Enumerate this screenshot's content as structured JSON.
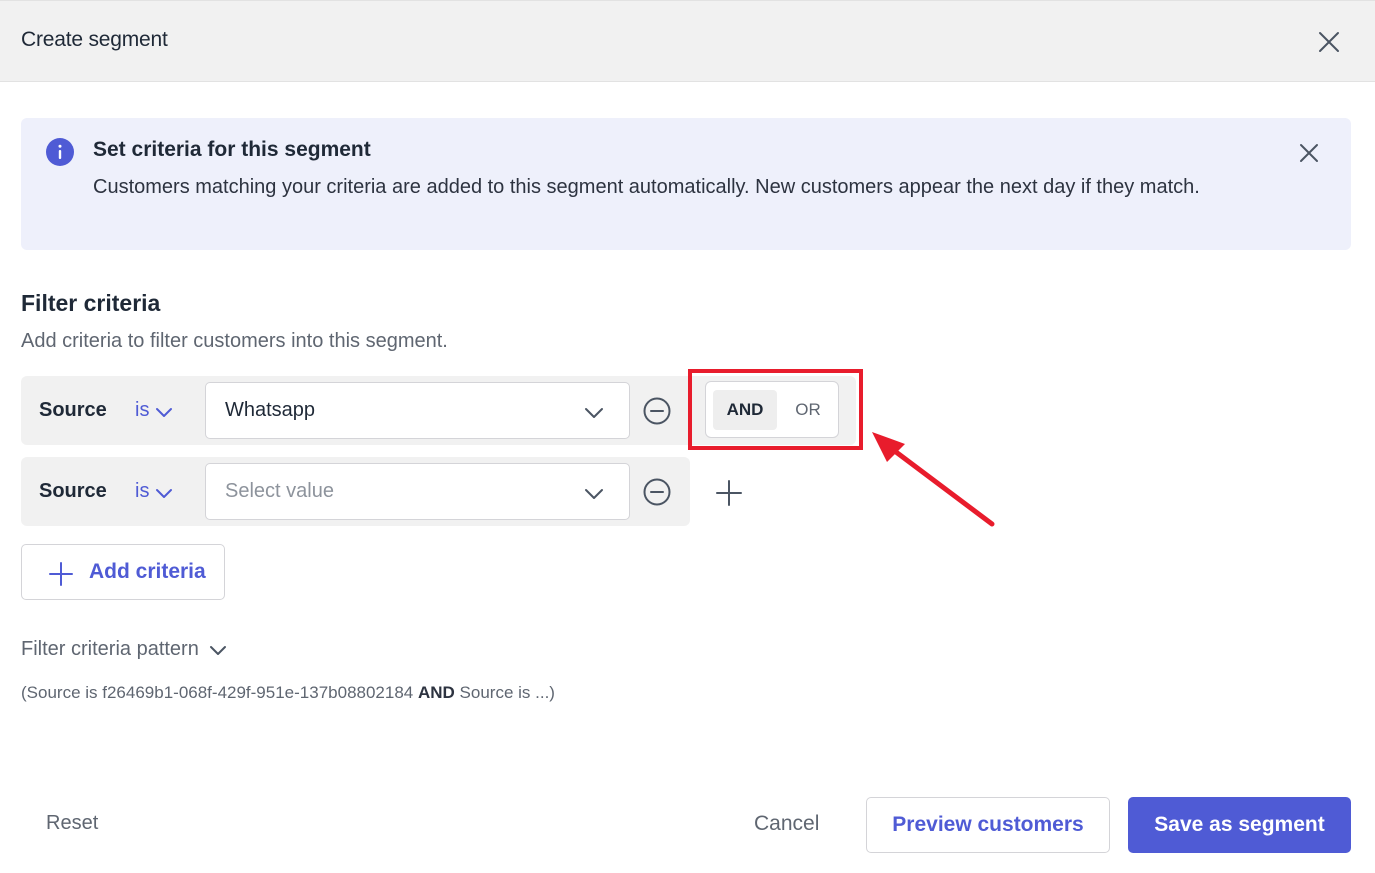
{
  "header": {
    "title": "Create segment",
    "close_icon": "close-icon"
  },
  "banner": {
    "icon": "info-icon",
    "title": "Set criteria for this segment",
    "text": "Customers matching your criteria are added to this segment automatically. New customers appear the next day if they match.",
    "close_icon": "close-icon"
  },
  "filter": {
    "title": "Filter criteria",
    "description": "Add criteria to filter customers into this segment.",
    "rows": [
      {
        "field": "Source",
        "operator": "is",
        "value": "Whatsapp"
      },
      {
        "field": "Source",
        "operator": "is",
        "placeholder": "Select value"
      }
    ],
    "logic": {
      "and_label": "AND",
      "or_label": "OR",
      "selected": "AND"
    },
    "add_label": "Add criteria"
  },
  "pattern": {
    "toggle_label": "Filter criteria pattern",
    "part1": "(Source is f26469b1-068f-429f-951e-137b08802184 ",
    "operator": "AND",
    "part2": " Source is ...)"
  },
  "footer": {
    "reset_label": "Reset",
    "cancel_label": "Cancel",
    "preview_label": "Preview customers",
    "save_label": "Save as segment"
  },
  "colors": {
    "accent": "#4f5bd5",
    "banner_bg": "#eef0fb",
    "annotation_red": "#e81c2c"
  }
}
